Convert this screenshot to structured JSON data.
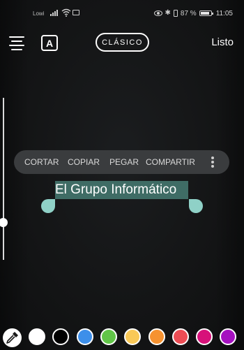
{
  "status_bar": {
    "carrier": "Lowi",
    "battery_text": "87 %",
    "battery_level": 0.87,
    "time": "11:05"
  },
  "toolbar": {
    "font_button_label": "A",
    "style_label": "CLÁSICO",
    "done_label": "Listo"
  },
  "text_size_slider": {
    "level": 0.77
  },
  "context_menu": {
    "items": [
      "CORTAR",
      "COPIAR",
      "PEGAR",
      "COMPARTIR"
    ]
  },
  "text_content": "El Grupo Informático",
  "colors": {
    "selection": "#3f6c65",
    "handles": "#8fd1c7",
    "menu_background": "#3a3c3e"
  },
  "palette": {
    "swatches": [
      "#ffffff",
      "#000000",
      "#3d8fea",
      "#61c548",
      "#f9c957",
      "#f69230",
      "#ec4c54",
      "#d7127a",
      "#a511c0"
    ]
  }
}
